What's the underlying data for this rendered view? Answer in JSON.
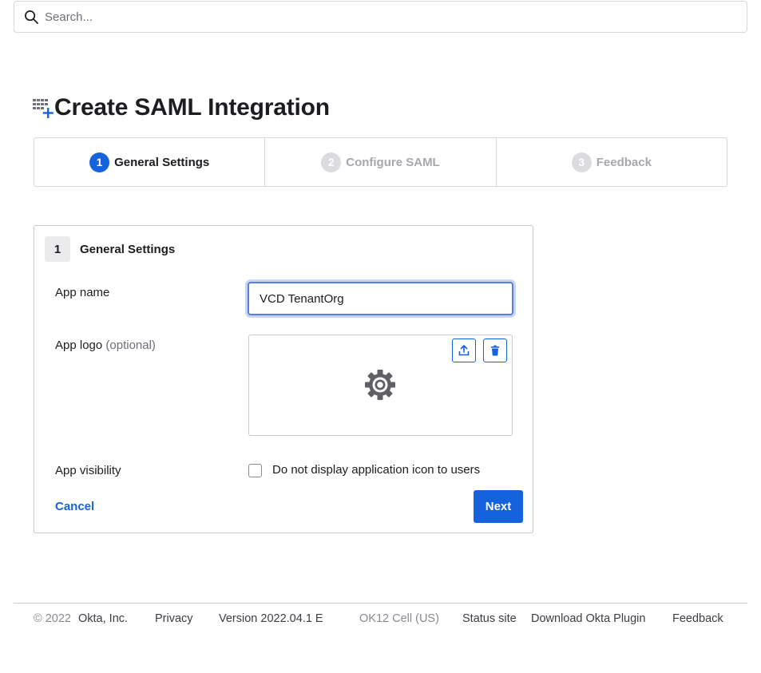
{
  "search": {
    "placeholder": "Search..."
  },
  "page": {
    "title": "Create SAML Integration"
  },
  "wizard": {
    "steps": [
      {
        "number": "1",
        "label": "General Settings",
        "state": "active"
      },
      {
        "number": "2",
        "label": "Configure SAML",
        "state": "inactive"
      },
      {
        "number": "3",
        "label": "Feedback",
        "state": "inactive"
      }
    ]
  },
  "panel": {
    "number": "1",
    "title": "General Settings",
    "app_name_label": "App name",
    "app_name_value": "VCD TenantOrg",
    "app_logo_label": "App logo",
    "app_logo_optional": "(optional)",
    "app_visibility_label": "App visibility",
    "visibility_checkbox_label": "Do not display application icon to users",
    "visibility_checked": false,
    "cancel_label": "Cancel",
    "next_label": "Next"
  },
  "footer": {
    "copyright_year": "© 2022",
    "company": "Okta, Inc.",
    "privacy": "Privacy",
    "version": "Version 2022.04.1 E",
    "cell": "OK12 Cell (US)",
    "status_site": "Status site",
    "download_plugin": "Download Okta Plugin",
    "feedback": "Feedback"
  },
  "colors": {
    "accent": "#1662dd",
    "border": "#d7d7dc",
    "muted_text": "#8a8a93"
  },
  "icons": {
    "search": "search-icon",
    "app_add": "app-add-icon",
    "upload": "upload-icon",
    "delete": "trash-icon",
    "logo_placeholder": "gear-icon"
  }
}
